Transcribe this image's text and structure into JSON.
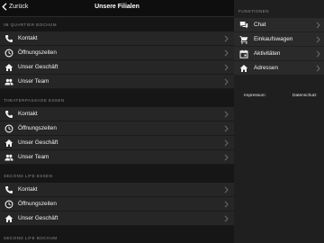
{
  "colors": {
    "background": "#1c1c1c",
    "row": "#262626",
    "section_label": "#8a8a8a",
    "chevron": "#6e6e6e"
  },
  "navbar": {
    "back_label": "Zurück",
    "title": "Unsere Filialen"
  },
  "sections": [
    {
      "label": "IM QUARTIER BOCHUM",
      "items": [
        {
          "label": "Kontakt",
          "icon": "phone-icon"
        },
        {
          "label": "Öffnungszeiten",
          "icon": "clock-icon"
        },
        {
          "label": "Unser Geschäft",
          "icon": "home-icon"
        },
        {
          "label": "Unser Team",
          "icon": "people-icon"
        }
      ]
    },
    {
      "label": "THEATERPASSAGE ESSEN",
      "items": [
        {
          "label": "Kontakt",
          "icon": "phone-icon"
        },
        {
          "label": "Öffnungszeiten",
          "icon": "clock-icon"
        },
        {
          "label": "Unser Geschäft",
          "icon": "home-icon"
        },
        {
          "label": "Unser Team",
          "icon": "people-icon"
        }
      ]
    },
    {
      "label": "SECOND LIFE ESSEN",
      "items": [
        {
          "label": "Kontakt",
          "icon": "phone-icon"
        },
        {
          "label": "Öffnungszeiten",
          "icon": "clock-icon"
        },
        {
          "label": "Unser Geschäft",
          "icon": "home-icon"
        }
      ]
    },
    {
      "label": "SECOND LIFE BOCHUM",
      "items": []
    }
  ],
  "menu": {
    "header": "FUNKTIONEN",
    "items": [
      {
        "label": "Chat",
        "icon": "chat-icon"
      },
      {
        "label": "Einkaufswagen",
        "icon": "cart-icon"
      },
      {
        "label": "Aktivitäten",
        "icon": "calendar-icon"
      },
      {
        "label": "Adressen",
        "icon": "home-icon"
      }
    ]
  },
  "footer": {
    "impressum": "Impressum",
    "datenschutz": "Datenschutz"
  }
}
